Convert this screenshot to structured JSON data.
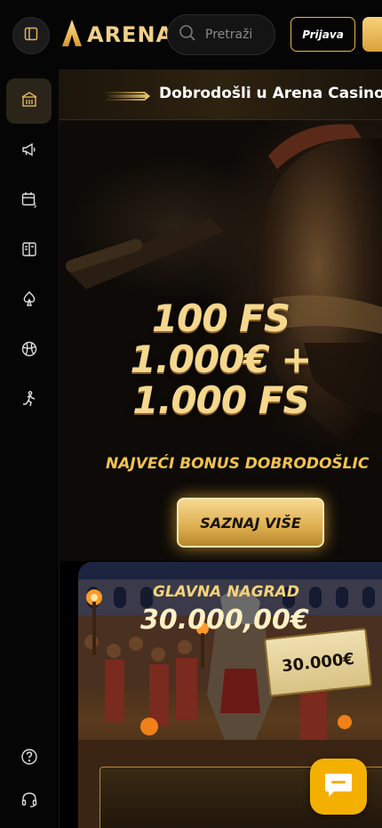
{
  "header": {
    "logo_text": "ARENA",
    "search_placeholder": "Pretraži",
    "login_label": "Prijava"
  },
  "sidebar": {
    "items": [
      {
        "icon": "casino-icon",
        "active": true
      },
      {
        "icon": "megaphone-icon",
        "active": false
      },
      {
        "icon": "calendar-icon",
        "active": false
      },
      {
        "icon": "book-icon",
        "active": false
      },
      {
        "icon": "spade-icon",
        "active": false
      },
      {
        "icon": "ball-icon",
        "active": false
      },
      {
        "icon": "runner-icon",
        "active": false
      }
    ],
    "bottom_items": [
      {
        "icon": "help-icon"
      },
      {
        "icon": "headset-icon"
      }
    ]
  },
  "ticker": {
    "text": "Dobrodošli u Arena Casino,"
  },
  "hero": {
    "lines": [
      "100 FS",
      "1.000€ +",
      "1.000 FS"
    ],
    "subtitle": "NAJVEĆI BONUS DOBRODOŠLIC",
    "cta_label": "SAZNAJ VIŠE"
  },
  "promo": {
    "cheque_amount": "30.000€",
    "title": "GLAVNA NAGRAD",
    "amount": "30.000,00€"
  },
  "colors": {
    "accent_gold": "#f0c25a",
    "chat_button": "#f4b000",
    "background": "#000000"
  }
}
